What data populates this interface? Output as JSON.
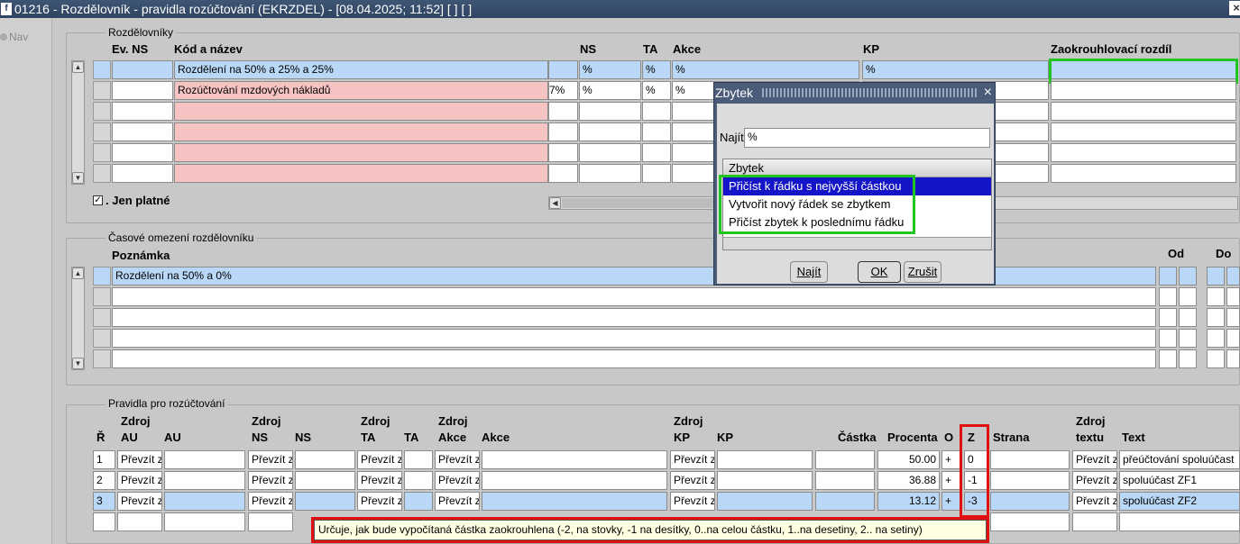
{
  "window": {
    "title": "01216 - Rozdělovník - pravidla rozúčtování (EKRZDEL) - [08.04.2025; 11:52]  [ ]  [ ]",
    "logo": "f",
    "close": "×"
  },
  "nav": {
    "label": "Nav"
  },
  "rozdelovniky": {
    "section_label": "Rozdělovníky",
    "headers": {
      "ev_ns": "Ev. NS",
      "kod": "Kód a název",
      "ns": "NS",
      "ta": "TA",
      "akce": "Akce",
      "kp": "KP",
      "zaokr": "Zaokrouhlovací rozdíl"
    },
    "rows": [
      {
        "kod": "Rozdělení na 50% a 25% a 25%",
        "pct": "",
        "ns": "%",
        "ta": "%",
        "akce": "%",
        "kp": "%"
      },
      {
        "kod": "Rozúčtování mzdových nákladů",
        "pct": "7%",
        "ns": "%",
        "ta": "%",
        "akce": "%",
        "kp": ""
      }
    ],
    "jen_platne": "Jen platné"
  },
  "casove": {
    "section_label": "Časové omezení rozdělovníku",
    "headers": {
      "poznamka": "Poznámka",
      "od": "Od",
      "do": "Do"
    },
    "rows": [
      {
        "poznamka": "Rozdělení na 50% a 0%"
      }
    ]
  },
  "pravidla": {
    "section_label": "Pravidla pro rozúčtování",
    "headers": {
      "r": "Ř",
      "zdroj": "Zdroj",
      "au1": "AU",
      "au2": "AU",
      "ns1": "NS",
      "ns2": "NS",
      "ta1": "TA",
      "ta2": "TA",
      "akce1": "Akce",
      "akce2": "Akce",
      "kp1": "KP",
      "kp2": "KP",
      "castka": "Částka",
      "procenta": "Procenta",
      "o": "O",
      "z": "Z",
      "strana": "Strana",
      "textu": "textu",
      "text": "Text"
    },
    "rows": [
      {
        "r": "1",
        "src": "Převzít z",
        "procenta": "50.00",
        "o": "+",
        "z": "0",
        "text": "přeúčtování spoluúčast"
      },
      {
        "r": "2",
        "src": "Převzít z",
        "procenta": "36.88",
        "o": "+",
        "z": "-1",
        "text": "spoluúčast ZF1"
      },
      {
        "r": "3",
        "src": "Převzít z",
        "procenta": "13.12",
        "o": "+",
        "z": "-3",
        "text": "spoluúčast ZF2"
      }
    ],
    "tooltip": "Určuje, jak bude vypočítaná částka zaokrouhlena (-2, na stovky, -1 na desítky, 0..na celou částku, 1..na desetiny, 2.. na setiny)"
  },
  "dialog": {
    "title": "Zbytek",
    "close": "×",
    "find_label": "Najít",
    "find_value": "%",
    "list_header": "Zbytek",
    "items": [
      "Přičíst k řádku s nejvyšší částkou",
      "Vytvořit nový řádek se zbytkem",
      "Přičíst zbytek k poslednímu řádku"
    ],
    "btn_find": "Najít",
    "btn_ok": "OK",
    "btn_cancel": "Zrušit"
  }
}
